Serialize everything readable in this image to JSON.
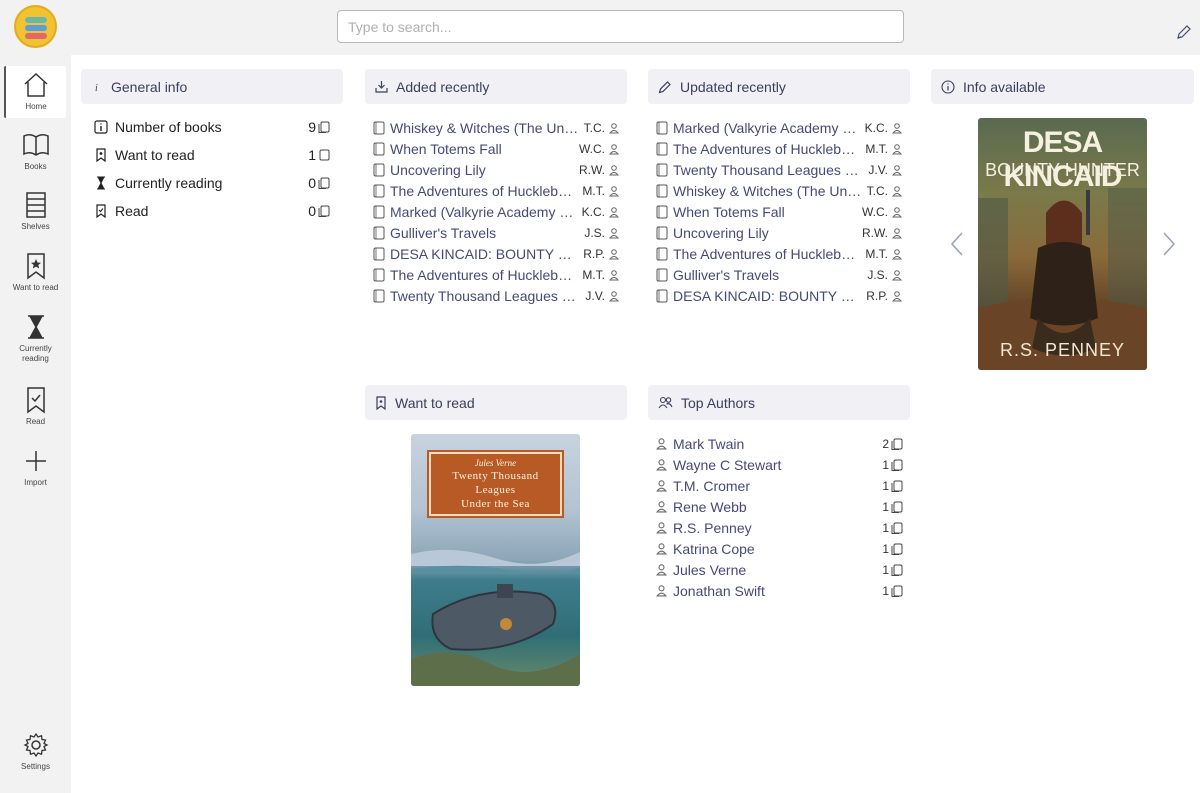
{
  "search": {
    "placeholder": "Type to search..."
  },
  "sidebar": {
    "items": [
      {
        "label": "Home"
      },
      {
        "label": "Books"
      },
      {
        "label": "Shelves"
      },
      {
        "label": "Want to read"
      },
      {
        "label": "Currently reading"
      },
      {
        "label": "Read"
      },
      {
        "label": "Import"
      },
      {
        "label": "Settings"
      }
    ]
  },
  "general_info": {
    "title": "General info",
    "rows": [
      {
        "label": "Number of books",
        "count": "9"
      },
      {
        "label": "Want to read",
        "count": "1"
      },
      {
        "label": "Currently reading",
        "count": "0"
      },
      {
        "label": "Read",
        "count": "0"
      }
    ]
  },
  "added_recently": {
    "title": "Added recently",
    "books": [
      {
        "title": "Whiskey & Witches (The Unlikely Heroes Book 1)",
        "author": "T.C."
      },
      {
        "title": "When Totems Fall",
        "author": "W.C."
      },
      {
        "title": "Uncovering Lily",
        "author": "R.W."
      },
      {
        "title": "The Adventures of Huckleberry Finn",
        "author": "M.T."
      },
      {
        "title": "Marked (Valkyrie Academy Book 1)",
        "author": "K.C."
      },
      {
        "title": "Gulliver's Travels",
        "author": "J.S."
      },
      {
        "title": "DESA KINCAID: BOUNTY HUNTER",
        "author": "R.P."
      },
      {
        "title": "The Adventures of Huckleberry Finn",
        "author": "M.T."
      },
      {
        "title": "Twenty Thousand Leagues Under the Sea",
        "author": "J.V."
      }
    ]
  },
  "updated_recently": {
    "title": "Updated recently",
    "books": [
      {
        "title": "Marked (Valkyrie Academy Book 1)",
        "author": "K.C."
      },
      {
        "title": "The Adventures of Huckleberry Finn",
        "author": "M.T."
      },
      {
        "title": "Twenty Thousand Leagues Under the Sea",
        "author": "J.V."
      },
      {
        "title": "Whiskey & Witches (The Unlikely Heroes Book 1)",
        "author": "T.C."
      },
      {
        "title": "When Totems Fall",
        "author": "W.C."
      },
      {
        "title": "Uncovering Lily",
        "author": "R.W."
      },
      {
        "title": "The Adventures of Huckleberry Finn",
        "author": "M.T."
      },
      {
        "title": "Gulliver's Travels",
        "author": "J.S."
      },
      {
        "title": "DESA KINCAID: BOUNTY HUNTER",
        "author": "R.P."
      }
    ]
  },
  "info_available": {
    "title": "Info available",
    "cover": {
      "line1": "DESA KINCAID",
      "line2": "BOUNTY HUNTER",
      "author": "R.S. PENNEY"
    }
  },
  "want_to_read": {
    "title": "Want to read",
    "cover": {
      "author": "Jules Verne",
      "line1": "Twenty Thousand",
      "line2": "Leagues",
      "line3": "Under the Sea"
    }
  },
  "top_authors": {
    "title": "Top Authors",
    "authors": [
      {
        "name": "Mark Twain",
        "count": "2"
      },
      {
        "name": "Wayne C Stewart",
        "count": "1"
      },
      {
        "name": "T.M. Cromer",
        "count": "1"
      },
      {
        "name": "Rene Webb",
        "count": "1"
      },
      {
        "name": "R.S. Penney",
        "count": "1"
      },
      {
        "name": "Katrina Cope",
        "count": "1"
      },
      {
        "name": "Jules Verne",
        "count": "1"
      },
      {
        "name": "Jonathan Swift",
        "count": "1"
      }
    ]
  },
  "colors": {
    "accent": "#444a78",
    "card_head_bg": "#f0f0f5",
    "sidebar_bg": "#f2f2f2",
    "logo": "#f1c232"
  }
}
